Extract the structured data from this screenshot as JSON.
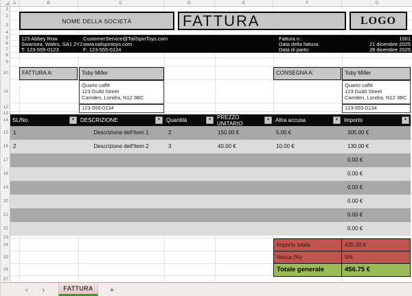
{
  "sheet": {
    "col_headers": [
      "A",
      "B",
      "C",
      "D",
      "E",
      "F",
      "G"
    ],
    "row_headers": [
      "1",
      "2",
      "3",
      "4",
      "5",
      "6",
      "7",
      "8",
      "9",
      "10",
      "11",
      "12",
      "13",
      "14",
      "15",
      "16",
      "17",
      "18",
      "19",
      "20",
      "21",
      "22",
      "23",
      "24",
      "25",
      "26",
      "27"
    ]
  },
  "banner": {
    "company_name": "NOME DELLA SOCIETÀ",
    "title": "FATTURA",
    "logo": "LOGO"
  },
  "company_info": {
    "address_line1": "123 Abbey Row",
    "address_line2": "Swansea, Wales, SA1 2Y2",
    "phone": "T: 123-555-0123",
    "email": "CustomerService@TailSpinToys.com",
    "website": "www.tailspintoys.com",
    "fax": "F: 123-555-0124"
  },
  "invoice_meta": {
    "number_label": "Fattura n.:",
    "number_value": "1001",
    "date_label": "Data della fattura:",
    "date_value": "21 dicembre 2025",
    "due_label": "Data di parto:",
    "due_value": "28 dicembre 2025"
  },
  "bill_to": {
    "label": "FATTURA A:",
    "name": "Toby Miller",
    "company": "Quarto caffè",
    "street": "123 Guild Street",
    "city": "Camden, Londra, N12 3BC",
    "phone": "123-555-0134"
  },
  "ship_to": {
    "label": "CONSEGNA A:",
    "name": "Toby Miller",
    "company": "Quarto caffè",
    "street": "123 Guild Street",
    "city": "Camden, Londra, N12 3BC",
    "phone": "123-555-0134"
  },
  "items_table": {
    "columns": [
      "SL/No.",
      "DESCRIZIONE",
      "Quantità",
      "PREZZO UNITARIO",
      "Altra accusa",
      "Importo"
    ],
    "filter_icon": "▾",
    "rows": [
      {
        "sl": "1",
        "desc": "Descrizione dell'Item 1",
        "qty": "2",
        "price": "150.00 €",
        "extra": "5.00 €",
        "amount": "305.00 €"
      },
      {
        "sl": "2",
        "desc": "Descrizione dell'Item 2",
        "qty": "3",
        "price": "40.00 €",
        "extra": "10.00 €",
        "amount": "130.00 €"
      },
      {
        "sl": "",
        "desc": "",
        "qty": "",
        "price": "",
        "extra": "",
        "amount": "0.00 €"
      },
      {
        "sl": "",
        "desc": "",
        "qty": "",
        "price": "",
        "extra": "",
        "amount": "0.00 €"
      },
      {
        "sl": "",
        "desc": "",
        "qty": "",
        "price": "",
        "extra": "",
        "amount": "0.00 €"
      },
      {
        "sl": "",
        "desc": "",
        "qty": "",
        "price": "",
        "extra": "",
        "amount": "0.00 €"
      },
      {
        "sl": "",
        "desc": "",
        "qty": "",
        "price": "",
        "extra": "",
        "amount": "0.00 €"
      },
      {
        "sl": "",
        "desc": "",
        "qty": "",
        "price": "",
        "extra": "",
        "amount": "0.00 €"
      }
    ]
  },
  "totals": {
    "subtotal_label": "Importo totale",
    "subtotal_value": "435.00 €",
    "tax_label": "Vasca (%)",
    "tax_value": "5%",
    "grand_label": "Totale generale",
    "grand_value": "456.75 €"
  },
  "tab_bar": {
    "prev_icon": "‹",
    "next_icon": "›",
    "sheet_tab": "FATTURA",
    "add_icon": "+"
  },
  "colors": {
    "band_dark": "#A8A8A8",
    "band_light": "#DBDBDB",
    "accent_red": "#C0544E",
    "accent_green": "#9CBA57",
    "tab_underline": "#44913E"
  }
}
